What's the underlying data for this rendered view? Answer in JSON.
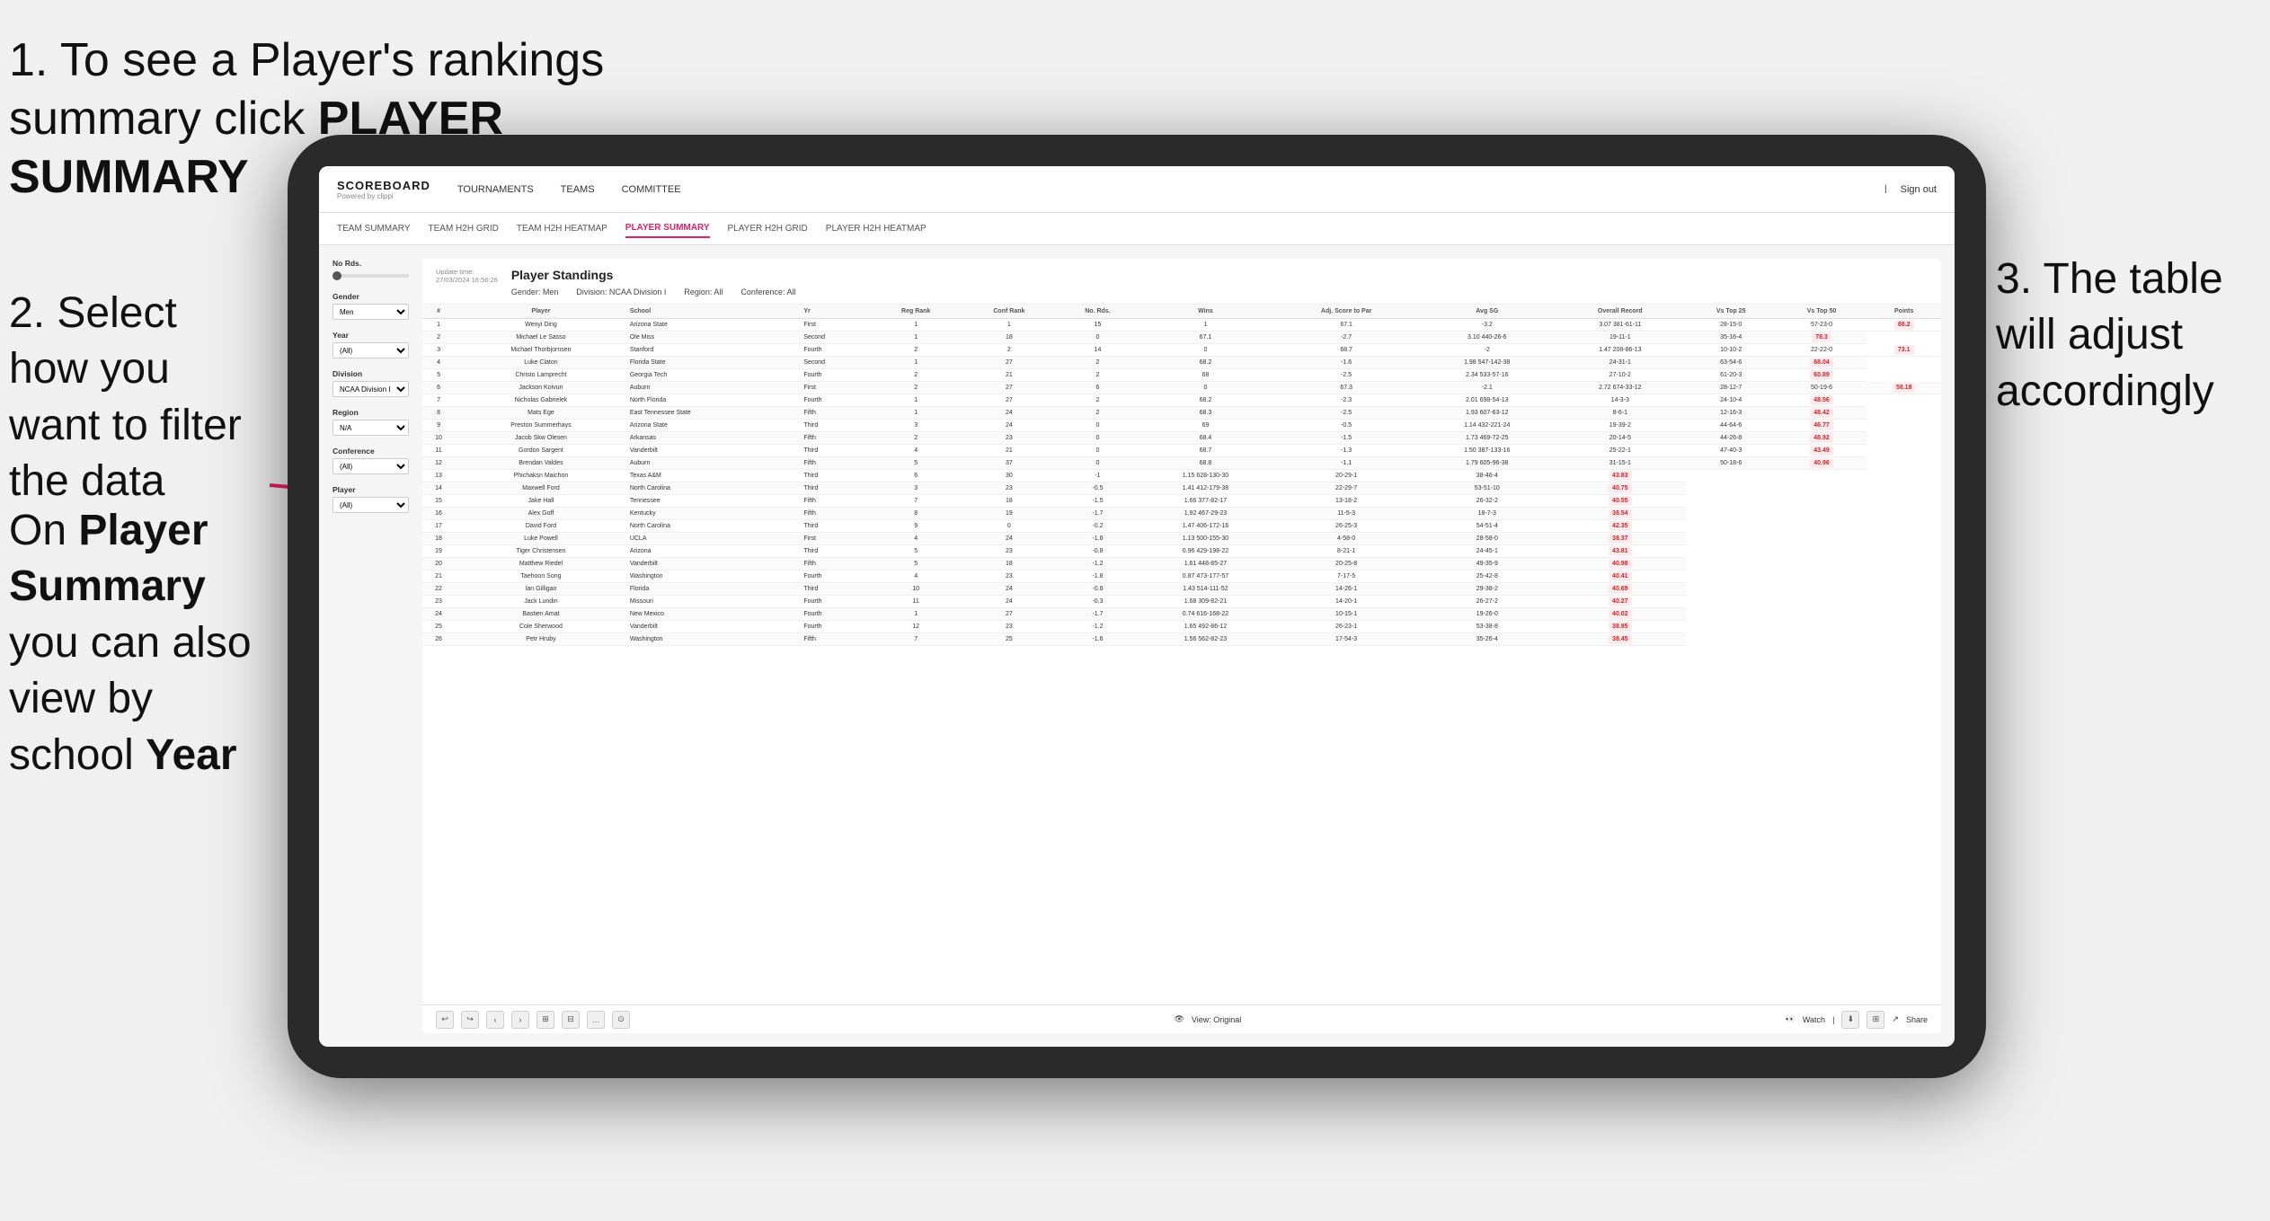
{
  "instructions": {
    "step1": "1. To see a Player's rankings summary click ",
    "step1_bold": "PLAYER SUMMARY",
    "step2_title": "2. Select how you want to filter the data",
    "step_footer_line1": "On ",
    "step_footer_bold": "Player Summary",
    "step_footer_line2": " you can also view by school ",
    "step_footer_year": "Year",
    "step3_title": "3. The table will adjust accordingly"
  },
  "nav": {
    "logo": "SCOREBOARD",
    "logo_sub": "Powered by clippi",
    "links": [
      "TOURNAMENTS",
      "TEAMS",
      "COMMITTEE"
    ],
    "sign_out": "Sign out"
  },
  "subnav": {
    "links": [
      "TEAM SUMMARY",
      "TEAM H2H GRID",
      "TEAM H2H HEATMAP",
      "PLAYER SUMMARY",
      "PLAYER H2H GRID",
      "PLAYER H2H HEATMAP"
    ],
    "active": "PLAYER SUMMARY"
  },
  "filters": {
    "no_rds_label": "No Rds.",
    "gender_label": "Gender",
    "gender_value": "Men",
    "year_label": "Year",
    "year_value": "(All)",
    "division_label": "Division",
    "division_value": "NCAA Division I",
    "region_label": "Region",
    "region_value": "N/A",
    "conference_label": "Conference",
    "conference_value": "(All)",
    "player_label": "Player",
    "player_value": "(All)"
  },
  "table": {
    "update_time": "Update time:",
    "update_date": "27/03/2024 16:56:26",
    "title": "Player Standings",
    "meta": {
      "gender": "Gender: Men",
      "division": "Division: NCAA Division I",
      "region": "Region: All",
      "conference": "Conference: All"
    },
    "columns": [
      "#",
      "Player",
      "School",
      "Yr",
      "Reg Rank",
      "Conf Rank",
      "No. Rds.",
      "Wins",
      "Adj. Score to Par",
      "Avg SG",
      "Overall Record",
      "Vs Top 25",
      "Vs Top 50",
      "Points"
    ],
    "rows": [
      [
        1,
        "Wenyi Ding",
        "Arizona State",
        "First",
        1,
        1,
        15,
        1,
        67.1,
        -3.2,
        "3.07 381-61-11",
        "28-15-0",
        "57-23-0",
        "88.2"
      ],
      [
        2,
        "Michael Le Sasso",
        "Ole Miss",
        "Second",
        1,
        18,
        0,
        67.1,
        -2.7,
        "3.10 440-26-6",
        "19-11-1",
        "35-16-4",
        "78.3"
      ],
      [
        3,
        "Michael Thorbjornsen",
        "Stanford",
        "Fourth",
        2,
        2,
        14,
        0,
        68.7,
        -2.0,
        "1.47 208-86-13",
        "10-10-2",
        "22-22-0",
        "73.1"
      ],
      [
        4,
        "Luke Claton",
        "Florida State",
        "Second",
        1,
        27,
        2,
        68.2,
        -1.6,
        "1.98 547-142-38",
        "24-31-1",
        "63-54-6",
        "68.04"
      ],
      [
        5,
        "Christo Lamprecht",
        "Georgia Tech",
        "Fourth",
        2,
        21,
        2,
        68.0,
        -2.5,
        "2.34 533-57-16",
        "27-10-2",
        "61-20-3",
        "60.89"
      ],
      [
        6,
        "Jackson Koivun",
        "Auburn",
        "First",
        2,
        27,
        6,
        0,
        67.3,
        -2.1,
        "2.72 674-33-12",
        "28-12-7",
        "50-19-6",
        "58.18"
      ],
      [
        7,
        "Nicholas Gabrielek",
        "North Florida",
        "Fourth",
        1,
        27,
        2,
        68.2,
        -2.3,
        "2.01 698-54-13",
        "14-3-3",
        "24-10-4",
        "48.56"
      ],
      [
        8,
        "Mats Ege",
        "East Tennessee State",
        "Fifth",
        1,
        24,
        2,
        68.3,
        -2.5,
        "1.93 607-63-12",
        "8-6-1",
        "12-16-3",
        "48.42"
      ],
      [
        9,
        "Preston Summerhays",
        "Arizona State",
        "Third",
        3,
        24,
        0,
        69.0,
        -0.5,
        "1.14 432-221-24",
        "19-39-2",
        "44-64-6",
        "46.77"
      ],
      [
        10,
        "Jacob Skw Olesen",
        "Arkansas",
        "Fifth",
        2,
        23,
        0,
        68.4,
        -1.5,
        "1.73 469-72-25",
        "20-14-5",
        "44-26-8",
        "48.92"
      ],
      [
        11,
        "Gordon Sargent",
        "Vanderbilt",
        "Third",
        4,
        21,
        0,
        68.7,
        -1.3,
        "1.50 387-133-16",
        "25-22-1",
        "47-40-3",
        "43.49"
      ],
      [
        12,
        "Brendan Valdes",
        "Auburn",
        "Fifth",
        5,
        37,
        0,
        68.8,
        -1.1,
        "1.79 605-96-38",
        "31-15-1",
        "50-18-6",
        "40.96"
      ],
      [
        13,
        "Phichaksn Maichon",
        "Texas A&M",
        "Third",
        6,
        30,
        -1.0,
        "1.15 628-130-30",
        "20-29-1",
        "38-46-4",
        "43.83"
      ],
      [
        14,
        "Maxwell Ford",
        "North Carolina",
        "Third",
        3,
        23,
        -0.5,
        "1.41 412-179-38",
        "22-29-7",
        "53-51-10",
        "40.75"
      ],
      [
        15,
        "Jake Hall",
        "Tennessee",
        "Fifth",
        7,
        18,
        -1.5,
        "1.66 377-82-17",
        "13-18-2",
        "26-32-2",
        "40.55"
      ],
      [
        16,
        "Alex Goff",
        "Kentucky",
        "Fifth",
        8,
        19,
        -1.7,
        "1.92 467-29-23",
        "11-5-3",
        "18-7-3",
        "38.54"
      ],
      [
        17,
        "David Ford",
        "North Carolina",
        "Third",
        9,
        0,
        -0.2,
        "1.47 406-172-16",
        "26-25-3",
        "54-51-4",
        "42.35"
      ],
      [
        18,
        "Luke Powell",
        "UCLA",
        "First",
        4,
        24,
        -1.8,
        "1.13 500-155-30",
        "4-58-0",
        "28-58-0",
        "38.37"
      ],
      [
        19,
        "Tiger Christensen",
        "Arizona",
        "Third",
        5,
        23,
        -0.8,
        "0.96 429-198-22",
        "8-21-1",
        "24-45-1",
        "43.81"
      ],
      [
        20,
        "Matthew Riedel",
        "Vanderbilt",
        "Fifth",
        5,
        18,
        -1.2,
        "1.61 448-85-27",
        "20-25-8",
        "49-35-9",
        "40.98"
      ],
      [
        21,
        "Taehoon Song",
        "Washington",
        "Fourth",
        4,
        23,
        -1.8,
        "0.87 473-177-57",
        "7-17-5",
        "25-42-8",
        "40.41"
      ],
      [
        22,
        "Ian Gilligan",
        "Florida",
        "Third",
        10,
        24,
        -0.8,
        "1.43 514-111-52",
        "14-26-1",
        "29-38-2",
        "40.69"
      ],
      [
        23,
        "Jack Lundin",
        "Missouri",
        "Fourth",
        11,
        24,
        -0.3,
        "1.68 309-82-21",
        "14-20-1",
        "26-27-2",
        "40.27"
      ],
      [
        24,
        "Bastien Amat",
        "New Mexico",
        "Fourth",
        1,
        27,
        -1.7,
        "0.74 616-168-22",
        "10-15-1",
        "19-26-0",
        "40.02"
      ],
      [
        25,
        "Cole Sherwood",
        "Vanderbilt",
        "Fourth",
        12,
        23,
        -1.2,
        "1.65 492-86-12",
        "26-23-1",
        "53-38-8",
        "38.95"
      ],
      [
        26,
        "Petr Hruby",
        "Washington",
        "Fifth",
        7,
        25,
        -1.6,
        "1.56 562-82-23",
        "17-54-3",
        "35-26-4",
        "38.45"
      ]
    ]
  },
  "toolbar": {
    "view_label": "View: Original",
    "watch_label": "Watch",
    "share_label": "Share"
  }
}
